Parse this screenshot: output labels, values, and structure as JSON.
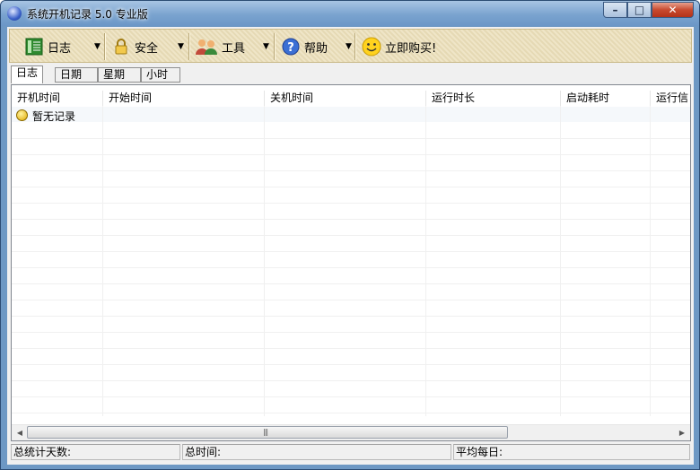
{
  "window": {
    "title": "系统开机记录 5.0 专业版",
    "minimize_glyph": "–",
    "maximize_glyph": "□",
    "close_glyph": "✕"
  },
  "toolbar": {
    "items": [
      {
        "label": "日志",
        "icon": "log-grid-icon",
        "has_dropdown": true
      },
      {
        "label": "安全",
        "icon": "padlock-icon",
        "has_dropdown": true
      },
      {
        "label": "工具",
        "icon": "users-tools-icon",
        "has_dropdown": true
      },
      {
        "label": "帮助",
        "icon": "help-icon",
        "has_dropdown": true
      },
      {
        "label": "立即购买!",
        "icon": "smiley-icon",
        "has_dropdown": false
      }
    ],
    "dropdown_glyph": "▼"
  },
  "tabs": [
    "日志",
    "日期",
    "星期",
    "小时"
  ],
  "active_tab": "日志",
  "table": {
    "columns": [
      "开机时间",
      "开始时间",
      "关机时间",
      "运行时长",
      "启动耗时",
      "运行信"
    ],
    "empty_text": "暂无记录"
  },
  "scrollbar": {
    "left_glyph": "◀",
    "right_glyph": "▶",
    "grip_glyph": "|||"
  },
  "statusbar": {
    "total_days_label": "总统计天数:",
    "total_time_label": "总时间:",
    "average_daily_label": "平均每日:"
  },
  "colors": {
    "title_bar": "#7aa3cf",
    "toolbar_bg": "#efe5c7",
    "close_button": "#c84a2f"
  }
}
